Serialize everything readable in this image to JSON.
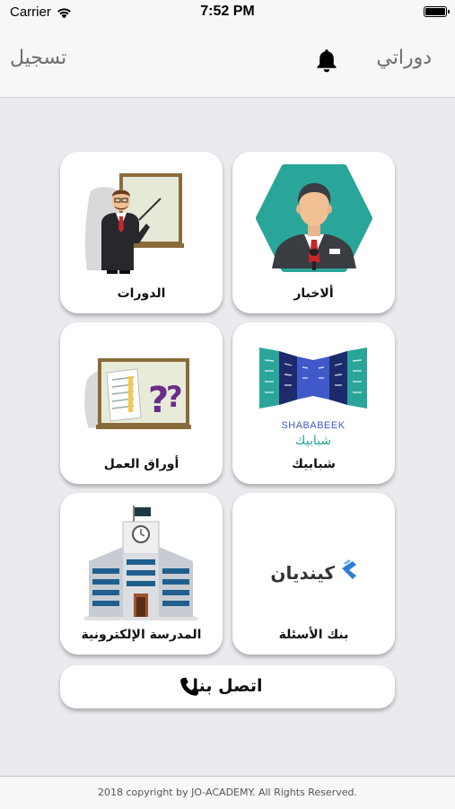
{
  "status_bar": {
    "carrier": "Carrier",
    "time": "7:52 PM"
  },
  "nav": {
    "register_label": "تسجيل",
    "my_courses_label": "دوراتي",
    "bell_icon": "bell-icon"
  },
  "tiles": [
    {
      "label": "ألاخبار",
      "icon": "news-anchor-icon"
    },
    {
      "label": "الدورات",
      "icon": "teacher-board-icon"
    },
    {
      "label": "شبابيك",
      "icon": "shababeek-logo",
      "logo_text_latin": "SHABABEEK",
      "logo_text_arabic": "شبابيك"
    },
    {
      "label": "أوراق العمل",
      "icon": "worksheet-board-icon"
    },
    {
      "label": "بنك الأسئلة",
      "icon": "kendian-logo",
      "logo_text": "كينديان"
    },
    {
      "label": "المدرسة الإلكترونية",
      "icon": "school-building-icon"
    }
  ],
  "contact": {
    "label": "اتصل بنا",
    "icon": "phone-icon"
  },
  "footer": {
    "text": "2018 copyright by JO-ACADEMY. All Rights Reserved."
  },
  "colors": {
    "background": "#e9ebef",
    "bar": "#f7f7f7",
    "teal": "#2aa59a",
    "navy": "#1d2a6b",
    "kendian_blue": "#2b7fd6"
  }
}
